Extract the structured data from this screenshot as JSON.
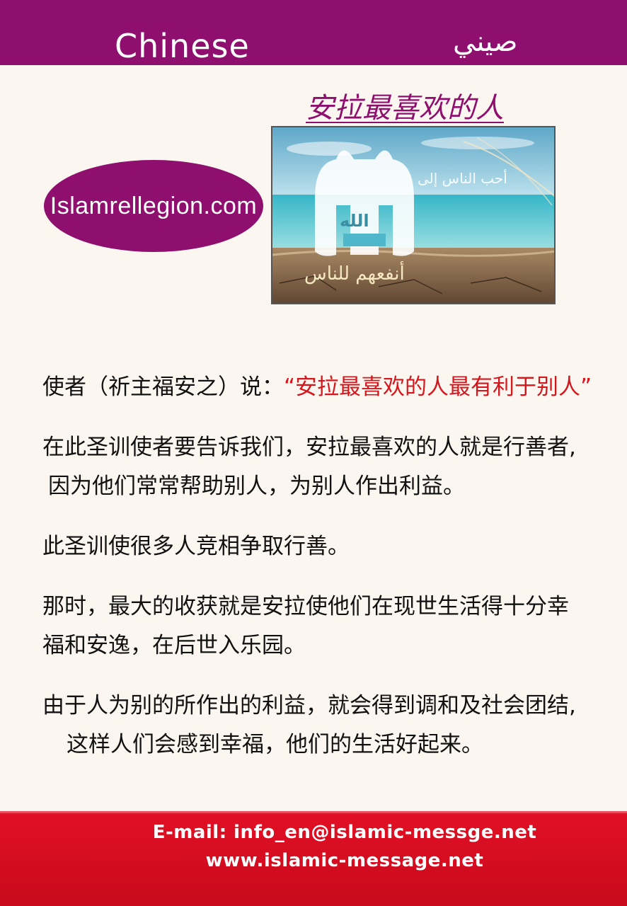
{
  "header": {
    "language_en": "Chinese",
    "language_ar": "صيني"
  },
  "title": "安拉最喜欢的人",
  "site_badge": "Islamrellegion.com",
  "image": {
    "arabic_top": "أحب الناس إلى",
    "arabic_bottom": "أنفعهم للناس",
    "arabic_center": "الله"
  },
  "body": {
    "p1_prefix": "使者（祈主福安之）说：",
    "p1_quote": "“安拉最喜欢的人最有利于别人”",
    "p2_line1": "在此圣训使者要告诉我们，安拉最喜欢的人就是行善者,",
    "p2_line2": "因为他们常常帮助别人，为别人作出利益。",
    "p3": "此圣训使很多人竞相争取行善。",
    "p4_line1": "那时，最大的收获就是安拉使他们在现世生活得十分幸",
    "p4_line2": "福和安逸，在后世入乐园。",
    "p5_line1": "由于人为别的所作出的利益，就会得到调和及社会团结,",
    "p5_line2": "这样人们会感到幸福，他们的生活好起来。"
  },
  "footer": {
    "email": "E-mail: info_en@islamic-messge.net",
    "website": "www.islamic-message.net"
  },
  "colors": {
    "brand_purple": "#8f0f6f",
    "quote_red": "#d6161c",
    "footer_red": "#e11024"
  }
}
